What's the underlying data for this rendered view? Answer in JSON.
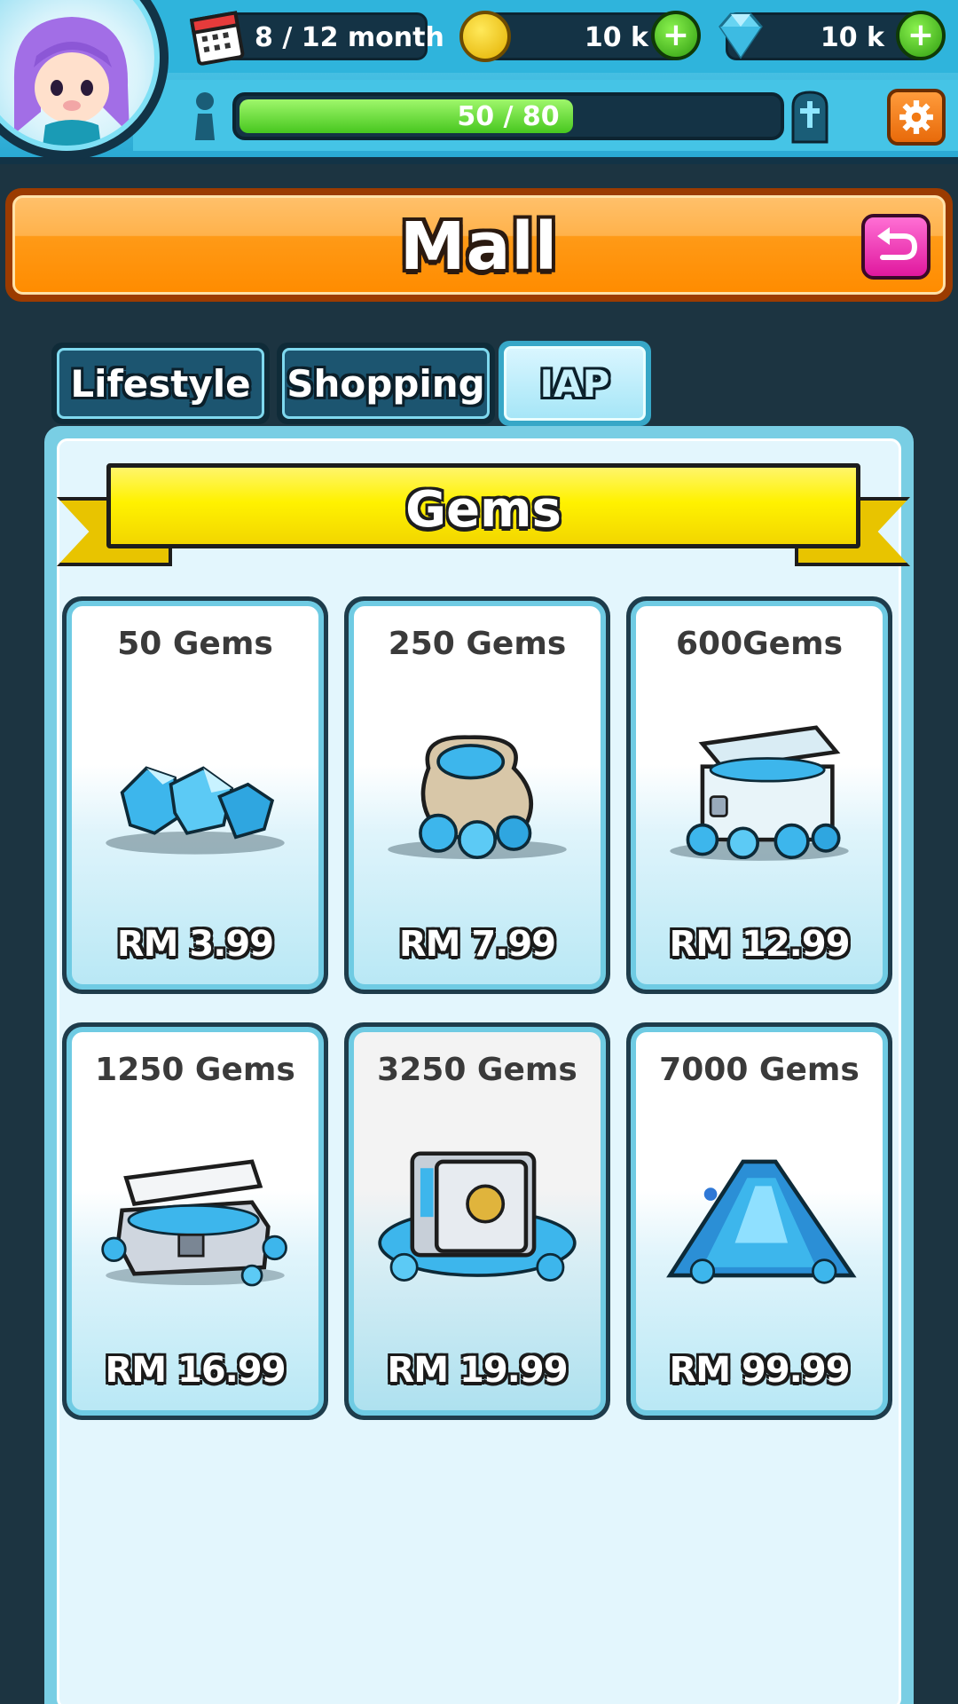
{
  "hud": {
    "month_label": "8 / 12 month",
    "coins": "10 k",
    "gems": "10 k",
    "xp": {
      "current": 50,
      "max": 80,
      "label": "50 / 80"
    }
  },
  "header": {
    "title": "Mall"
  },
  "tabs": [
    {
      "label": "Lifestyle",
      "active": false
    },
    {
      "label": "Shopping",
      "active": false
    },
    {
      "label": "IAP",
      "active": true
    }
  ],
  "section": {
    "title": "Gems"
  },
  "products": [
    {
      "title": "50 Gems",
      "price": "RM 3.99",
      "icon": "gem-cluster"
    },
    {
      "title": "250 Gems",
      "price": "RM 7.99",
      "icon": "gem-sack"
    },
    {
      "title": "600Gems",
      "price": "RM 12.99",
      "icon": "gem-chest"
    },
    {
      "title": "1250 Gems",
      "price": "RM 16.99",
      "icon": "gem-treasure-box"
    },
    {
      "title": "3250 Gems",
      "price": "RM 19.99",
      "icon": "gem-safe"
    },
    {
      "title": "7000 Gems",
      "price": "RM 99.99",
      "icon": "gem-mountain"
    }
  ],
  "colors": {
    "hud_bg": "#2fb4dc",
    "mall_bar": "#ff9a17",
    "ribbon": "#fff200",
    "card_border": "#6fcbe3",
    "plus_button": "#3fbf1a",
    "settings_button": "#f27a14",
    "back_button": "#e93db6"
  }
}
